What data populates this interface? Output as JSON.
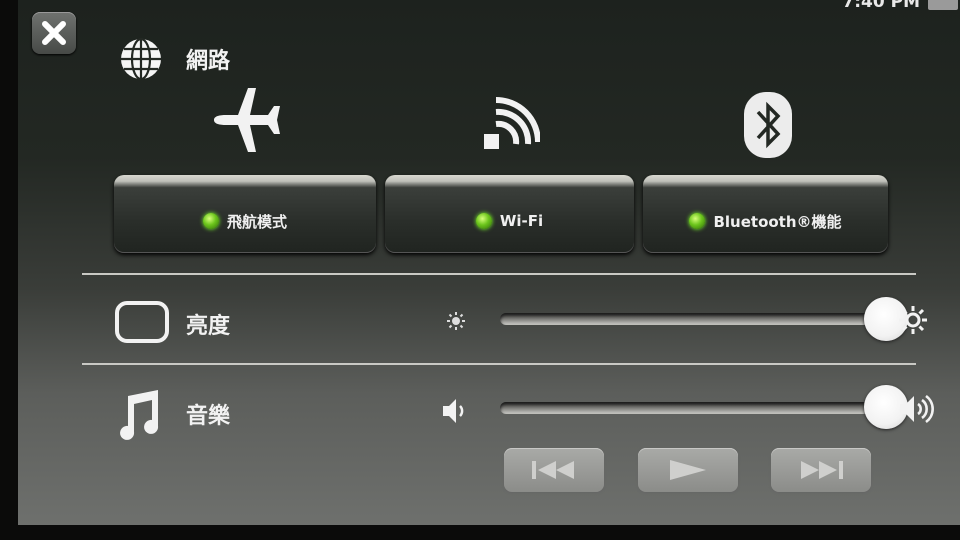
{
  "status": {
    "time": "7:40 PM"
  },
  "network": {
    "title": "網路",
    "airplane": {
      "label": "飛航模式",
      "on": true
    },
    "wifi": {
      "label": "Wi-Fi",
      "on": true
    },
    "bluetooth": {
      "label": "Bluetooth®機能",
      "on": true
    }
  },
  "brightness": {
    "title": "亮度",
    "level": 0.99
  },
  "music": {
    "title": "音樂",
    "volume": 0.99
  },
  "colors": {
    "led": "#6cc51c",
    "text": "#f2f2f2"
  },
  "icons": [
    "close-icon",
    "globe-icon",
    "airplane-icon",
    "wifi-icon",
    "bluetooth-icon",
    "screen-icon",
    "brightness-low-icon",
    "brightness-high-icon",
    "music-note-icon",
    "speaker-low-icon",
    "speaker-high-icon",
    "previous-icon",
    "play-icon",
    "next-icon"
  ]
}
